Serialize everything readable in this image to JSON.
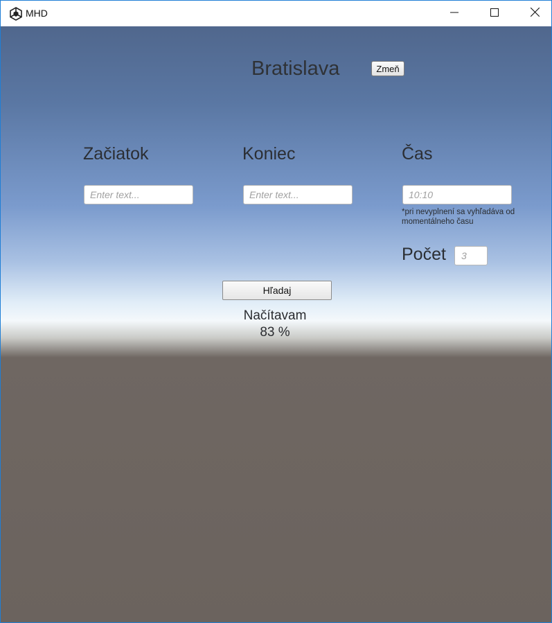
{
  "window": {
    "title": "MHD",
    "icons": {
      "app": "unity-logo-icon",
      "minimize": "minimize-icon",
      "maximize": "maximize-icon",
      "close": "close-icon"
    }
  },
  "header": {
    "city": "Bratislava",
    "change_button": "Zmeň"
  },
  "form": {
    "start": {
      "label": "Začiatok",
      "placeholder": "Enter text..."
    },
    "end": {
      "label": "Koniec",
      "placeholder": "Enter text..."
    },
    "time": {
      "label": "Čas",
      "placeholder": "10:10",
      "note": "*pri nevyplnení sa vyhľadáva od momentálneho času"
    },
    "count": {
      "label": "Počet",
      "placeholder": "3"
    },
    "search_button": "Hľadaj"
  },
  "status": {
    "text": "Načítavam",
    "progress": "83 %"
  },
  "colors": {
    "sky_top": "#50678d",
    "horizon": "#f4f8fb",
    "ground": "#6b635e",
    "text": "#2b2e33"
  }
}
